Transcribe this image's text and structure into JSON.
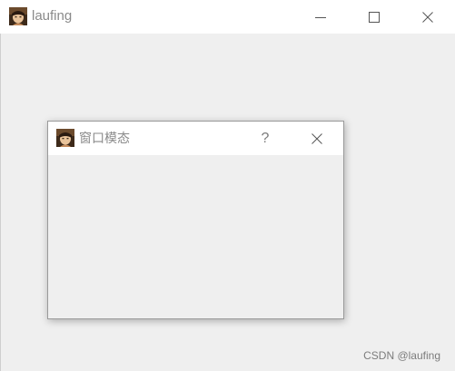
{
  "main_window": {
    "title": "laufing",
    "icon": "user-avatar-icon",
    "controls": [
      "minimize-icon",
      "maximize-icon",
      "close-icon"
    ]
  },
  "dialog": {
    "title": "窗口模态",
    "icon": "user-avatar-icon",
    "help_label": "?",
    "controls": [
      "help-icon",
      "close-icon"
    ]
  },
  "watermark": {
    "text": "CSDN @laufing"
  },
  "colors": {
    "client_background": "#efefef",
    "titlebar_background": "#ffffff",
    "title_text": "#8a8a8a",
    "control_glyph": "#555555"
  }
}
